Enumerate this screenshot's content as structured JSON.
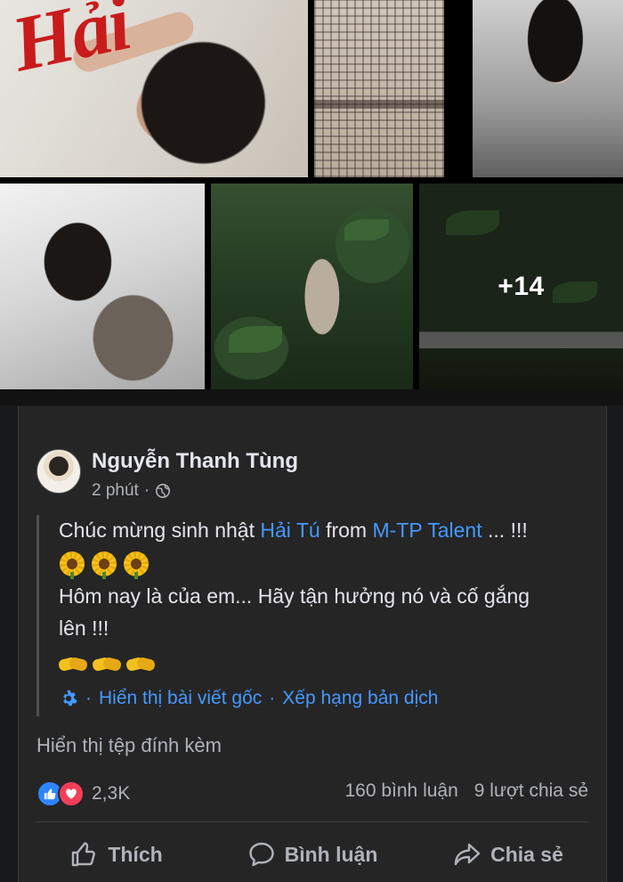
{
  "photos": {
    "cover_lettering": "Hải",
    "more_count": "+14"
  },
  "post": {
    "author": "Nguyễn Thanh Tùng",
    "time": "2 phút",
    "meta_separator": "·",
    "privacy_icon": "globe-icon",
    "text": {
      "line1_prefix": "Chúc mừng sinh nhật ",
      "mention1": "Hải Tú",
      "line1_mid": " from ",
      "mention2": "M-TP Talent",
      "line1_suffix": " ... !!!",
      "emoji_line1": [
        "sunflower",
        "sunflower",
        "sunflower"
      ],
      "line2": "Hôm nay là của em... Hãy tận hưởng nó và cố gắng",
      "line3": "lên !!!",
      "emoji_line2": [
        "handshake",
        "handshake",
        "handshake"
      ]
    },
    "translation": {
      "icon": "gear-icon",
      "dot": "·",
      "show_original": "Hiển thị bài viết gốc",
      "rate_translation": "Xếp hạng bản dịch"
    },
    "attachment_link": "Hiển thị tệp đính kèm",
    "stats": {
      "reaction_count": "2,3K",
      "comments": "160 bình luận",
      "shares": "9 lượt chia sẻ"
    },
    "actions": {
      "like": "Thích",
      "comment": "Bình luận",
      "share": "Chia sẻ"
    }
  },
  "colors": {
    "background": "#18191a",
    "card": "#252526",
    "link": "#4599ff",
    "like_blue": "#2d86ff",
    "love_red": "#f33e58",
    "secondary_text": "#b0b3b8"
  }
}
